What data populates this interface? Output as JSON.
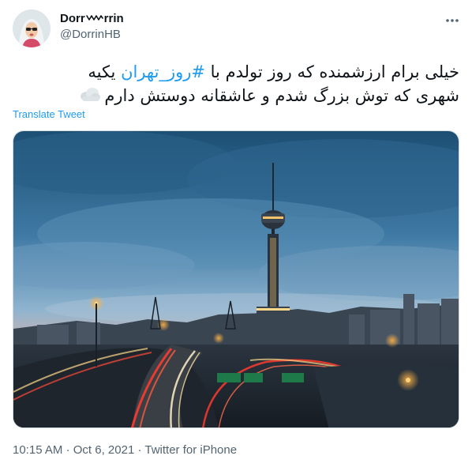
{
  "user": {
    "display_name_prefix": "Dorr",
    "display_name_suffix": "rrin",
    "handle": "@DorrinHB"
  },
  "tweet": {
    "line1_start": "خیلی برام ارزشمنده که روز تولدم با ",
    "hashtag": "#روز_تهران",
    "line1_end": " یکیه",
    "line2": "شهری که توش بزرگ شدم و عاشقانه دوستش دارم",
    "translate_label": "Translate Tweet"
  },
  "meta": {
    "time": "10:15 AM",
    "separator": " · ",
    "date": "Oct 6, 2021",
    "source": "Twitter for iPhone"
  },
  "icons": {
    "more": "more-icon",
    "emoji": "cloud-emoji-icon",
    "wave": "wave-emoji-icon"
  },
  "colors": {
    "link": "#1d9bf0",
    "secondary_text": "#536471",
    "primary_text": "#0f1419"
  }
}
